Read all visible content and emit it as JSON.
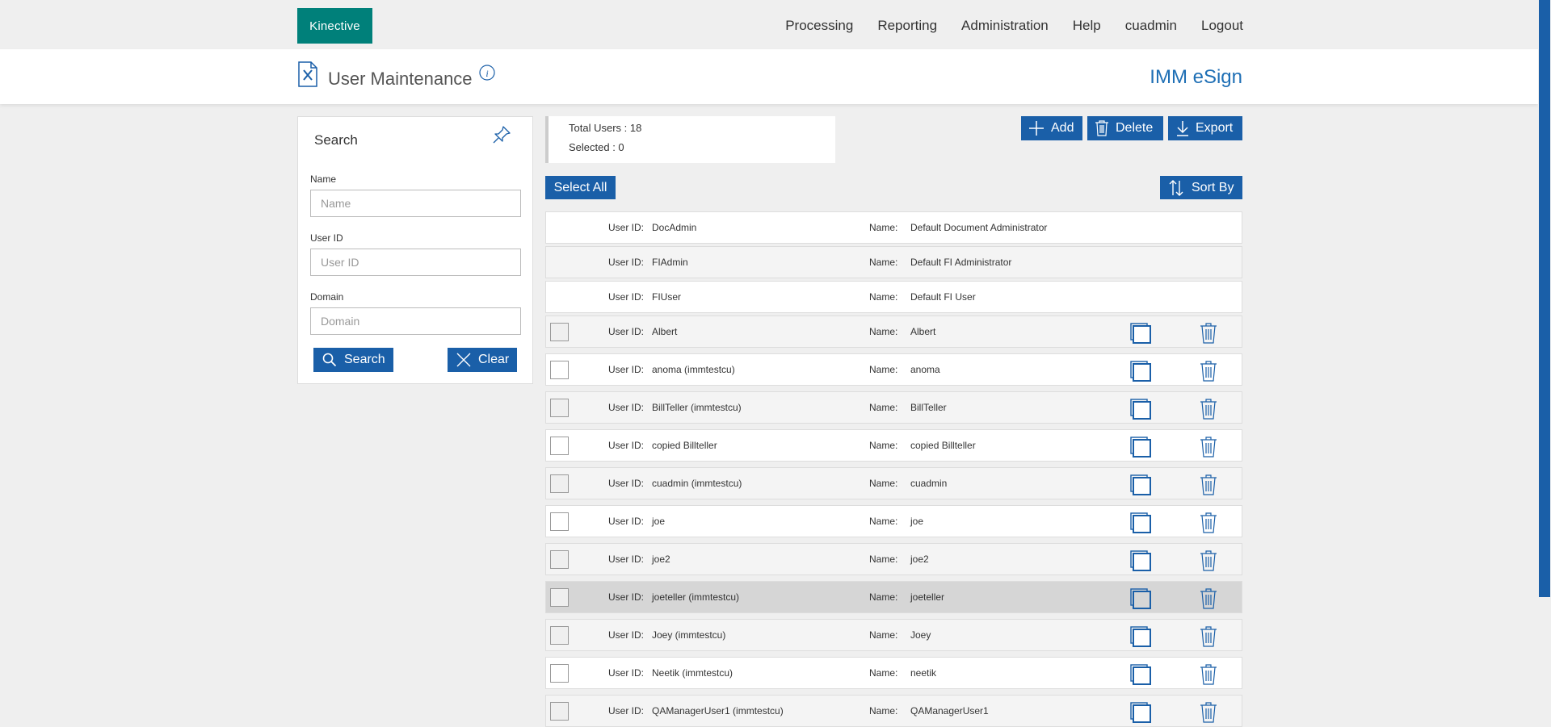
{
  "brand": {
    "logo": "Kinective",
    "color": "#00807a"
  },
  "nav": [
    "Processing",
    "Reporting",
    "Administration",
    "Help",
    "cuadmin",
    "Logout"
  ],
  "page": {
    "title": "User Maintenance",
    "app_name": "IMM eSign",
    "icon": "user-maintenance-icon",
    "info_icon": "info-icon"
  },
  "search": {
    "title": "Search",
    "name_label": "Name",
    "name_placeholder": "Name",
    "userid_label": "User ID",
    "userid_placeholder": "User ID",
    "domain_label": "Domain",
    "domain_placeholder": "Domain",
    "search_button": "Search",
    "clear_button": "Clear"
  },
  "summary": {
    "total": "Total Users : 18",
    "selected": "Selected : 0"
  },
  "toolbar": {
    "add": "Add",
    "delete": "Delete",
    "export": "Export",
    "select_all": "Select All",
    "sort_by": "Sort By"
  },
  "labels": {
    "user_id": "User ID:",
    "name": "Name:"
  },
  "users": [
    {
      "user_id": "DocAdmin",
      "name": "Default Document Administrator",
      "system": true
    },
    {
      "user_id": "FIAdmin",
      "name": "Default FI Administrator",
      "system": true
    },
    {
      "user_id": "FIUser",
      "name": "Default FI User",
      "system": true
    },
    {
      "user_id": "Albert",
      "name": "Albert"
    },
    {
      "user_id": "anoma (immtestcu)",
      "name": "anoma"
    },
    {
      "user_id": "BillTeller (immtestcu)",
      "name": "BillTeller"
    },
    {
      "user_id": "copied Billteller",
      "name": "copied Billteller"
    },
    {
      "user_id": "cuadmin (immtestcu)",
      "name": "cuadmin"
    },
    {
      "user_id": "joe",
      "name": "joe"
    },
    {
      "user_id": "joe2",
      "name": "joe2"
    },
    {
      "user_id": "joeteller (immtestcu)",
      "name": "joeteller",
      "highlighted": true
    },
    {
      "user_id": "Joey (immtestcu)",
      "name": "Joey"
    },
    {
      "user_id": "Neetik (immtestcu)",
      "name": "neetik"
    },
    {
      "user_id": "QAManagerUser1 (immtestcu)",
      "name": "QAManagerUser1"
    }
  ],
  "colors": {
    "primary": "#1a5fa8",
    "app_name": "#1e6fb5",
    "highlight_row": "#d6d6d6"
  }
}
